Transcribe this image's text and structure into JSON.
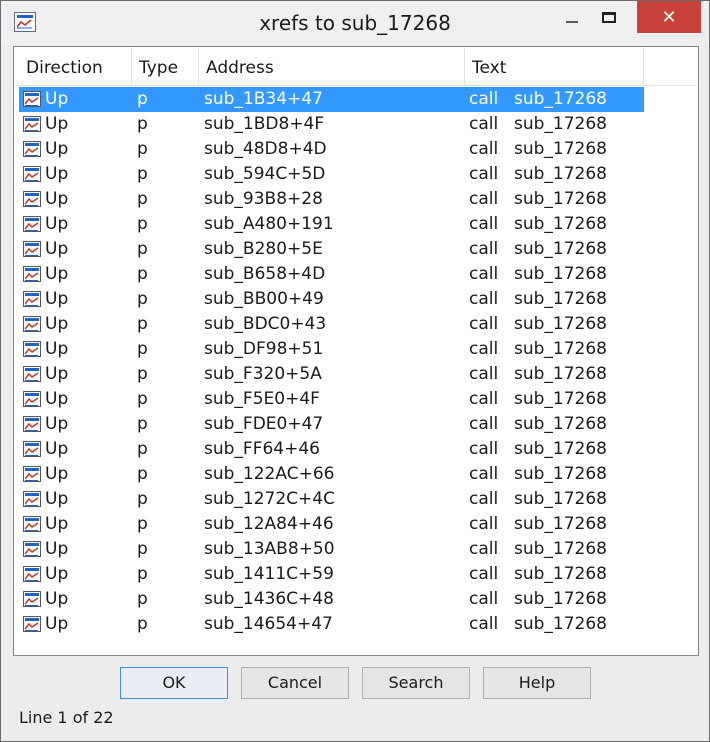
{
  "window": {
    "title": "xrefs to sub_17268",
    "close_glyph": "✕"
  },
  "columns": [
    "Direction",
    "Type",
    "Address",
    "Text"
  ],
  "rows": [
    {
      "direction": "Up",
      "type": "p",
      "address": "sub_1B34+47",
      "instr": "call",
      "target": "sub_17268"
    },
    {
      "direction": "Up",
      "type": "p",
      "address": "sub_1BD8+4F",
      "instr": "call",
      "target": "sub_17268"
    },
    {
      "direction": "Up",
      "type": "p",
      "address": "sub_48D8+4D",
      "instr": "call",
      "target": "sub_17268"
    },
    {
      "direction": "Up",
      "type": "p",
      "address": "sub_594C+5D",
      "instr": "call",
      "target": "sub_17268"
    },
    {
      "direction": "Up",
      "type": "p",
      "address": "sub_93B8+28",
      "instr": "call",
      "target": "sub_17268"
    },
    {
      "direction": "Up",
      "type": "p",
      "address": "sub_A480+191",
      "instr": "call",
      "target": "sub_17268"
    },
    {
      "direction": "Up",
      "type": "p",
      "address": "sub_B280+5E",
      "instr": "call",
      "target": "sub_17268"
    },
    {
      "direction": "Up",
      "type": "p",
      "address": "sub_B658+4D",
      "instr": "call",
      "target": "sub_17268"
    },
    {
      "direction": "Up",
      "type": "p",
      "address": "sub_BB00+49",
      "instr": "call",
      "target": "sub_17268"
    },
    {
      "direction": "Up",
      "type": "p",
      "address": "sub_BDC0+43",
      "instr": "call",
      "target": "sub_17268"
    },
    {
      "direction": "Up",
      "type": "p",
      "address": "sub_DF98+51",
      "instr": "call",
      "target": "sub_17268"
    },
    {
      "direction": "Up",
      "type": "p",
      "address": "sub_F320+5A",
      "instr": "call",
      "target": "sub_17268"
    },
    {
      "direction": "Up",
      "type": "p",
      "address": "sub_F5E0+4F",
      "instr": "call",
      "target": "sub_17268"
    },
    {
      "direction": "Up",
      "type": "p",
      "address": "sub_FDE0+47",
      "instr": "call",
      "target": "sub_17268"
    },
    {
      "direction": "Up",
      "type": "p",
      "address": "sub_FF64+46",
      "instr": "call",
      "target": "sub_17268"
    },
    {
      "direction": "Up",
      "type": "p",
      "address": "sub_122AC+66",
      "instr": "call",
      "target": "sub_17268"
    },
    {
      "direction": "Up",
      "type": "p",
      "address": "sub_1272C+4C",
      "instr": "call",
      "target": "sub_17268"
    },
    {
      "direction": "Up",
      "type": "p",
      "address": "sub_12A84+46",
      "instr": "call",
      "target": "sub_17268"
    },
    {
      "direction": "Up",
      "type": "p",
      "address": "sub_13AB8+50",
      "instr": "call",
      "target": "sub_17268"
    },
    {
      "direction": "Up",
      "type": "p",
      "address": "sub_1411C+59",
      "instr": "call",
      "target": "sub_17268"
    },
    {
      "direction": "Up",
      "type": "p",
      "address": "sub_1436C+48",
      "instr": "call",
      "target": "sub_17268"
    },
    {
      "direction": "Up",
      "type": "p",
      "address": "sub_14654+47",
      "instr": "call",
      "target": "sub_17268"
    }
  ],
  "buttons": {
    "ok": "OK",
    "cancel": "Cancel",
    "search": "Search",
    "help": "Help"
  },
  "status": "Line 1 of 22",
  "colors": {
    "selection": "#3399ff",
    "close_button": "#c7403a",
    "default_button_border": "#3c8fd8"
  }
}
